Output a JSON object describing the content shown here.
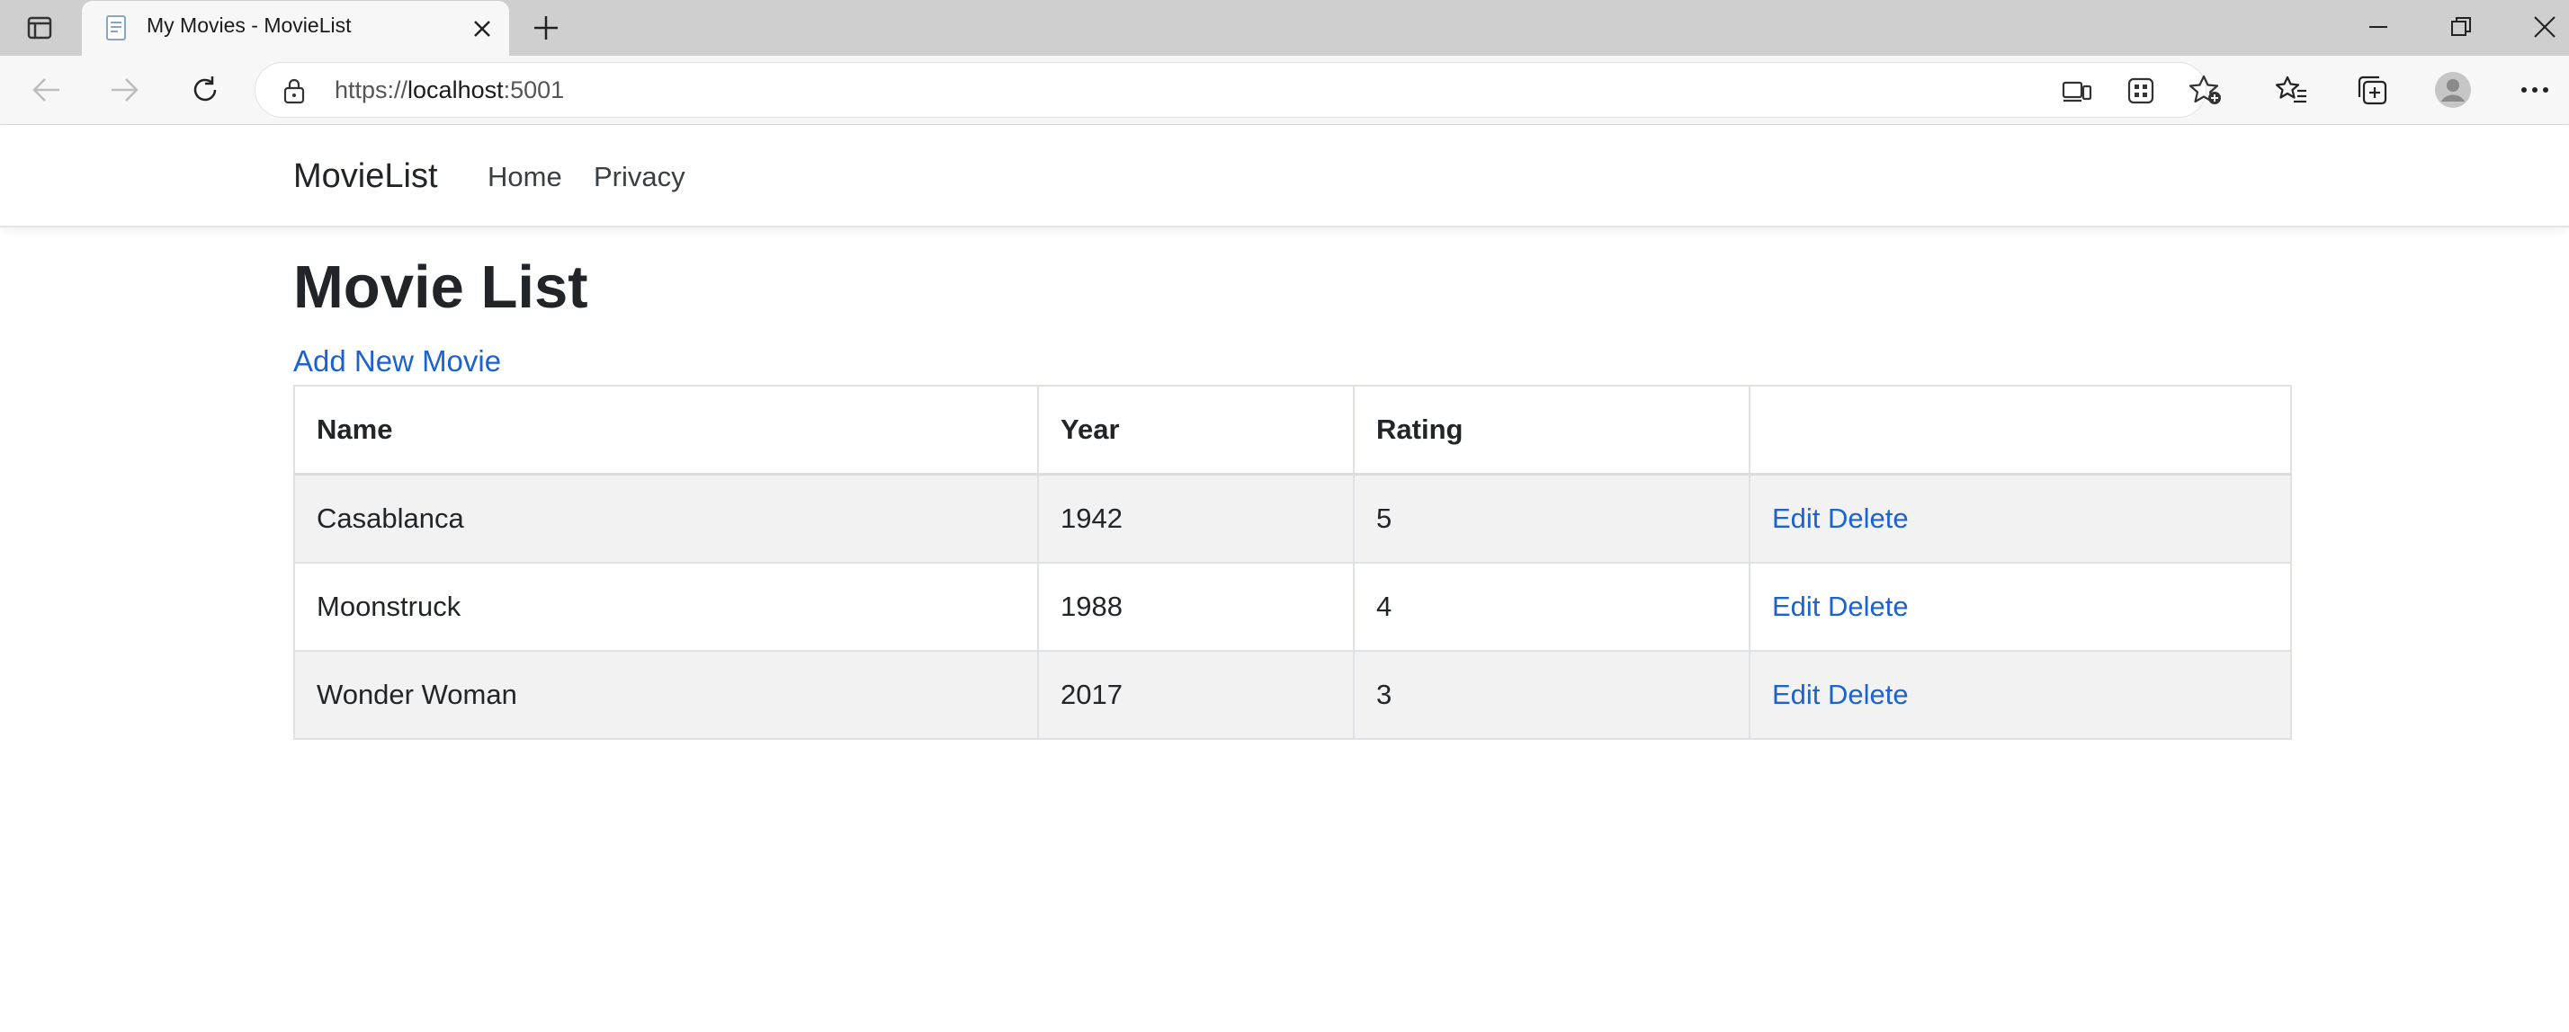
{
  "browser": {
    "tab_title": "My Movies - MovieList",
    "url_scheme": "https://",
    "url_host": "localhost",
    "url_port": ":5001"
  },
  "navbar": {
    "brand": "MovieList",
    "links": [
      "Home",
      "Privacy"
    ]
  },
  "main": {
    "title": "Movie List",
    "add_link": "Add New Movie",
    "table": {
      "headers": [
        "Name",
        "Year",
        "Rating",
        ""
      ],
      "rows": [
        {
          "name": "Casablanca",
          "year": "1942",
          "rating": "5",
          "edit": "Edit",
          "delete": "Delete"
        },
        {
          "name": "Moonstruck",
          "year": "1988",
          "rating": "4",
          "edit": "Edit",
          "delete": "Delete"
        },
        {
          "name": "Wonder Woman",
          "year": "2017",
          "rating": "3",
          "edit": "Edit",
          "delete": "Delete"
        }
      ]
    }
  },
  "colors": {
    "link": "#1e62cc",
    "stripe": "#f2f2f2",
    "tabstrip": "#cfcfcf"
  }
}
